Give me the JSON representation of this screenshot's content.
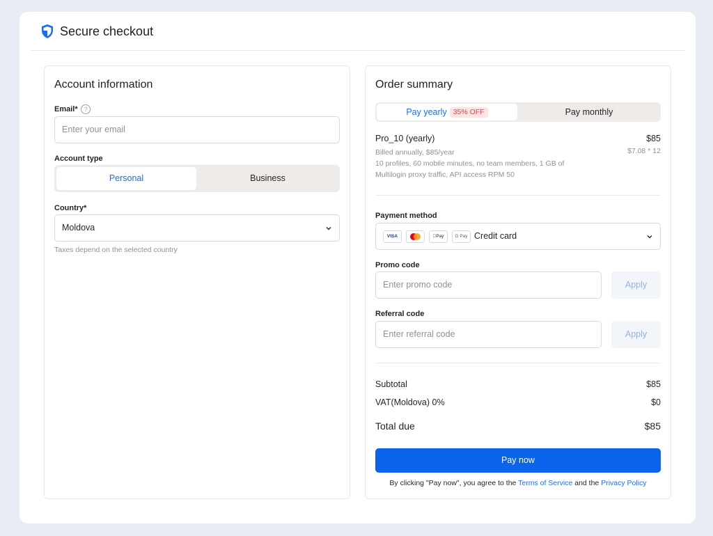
{
  "header": {
    "title": "Secure checkout",
    "icon": "shield-icon"
  },
  "account": {
    "title": "Account information",
    "email_label": "Email*",
    "email_placeholder": "Enter your email",
    "account_type_label": "Account type",
    "account_types": [
      "Personal",
      "Business"
    ],
    "account_type_selected": "Personal",
    "country_label": "Country*",
    "country_value": "Moldova",
    "country_hint": "Taxes depend on the selected country"
  },
  "order": {
    "title": "Order summary",
    "billing": {
      "yearly_label": "Pay yearly",
      "yearly_badge": "35% OFF",
      "monthly_label": "Pay monthly",
      "selected": "yearly"
    },
    "plan": {
      "name": "Pro_10 (yearly)",
      "price": "$85",
      "sub_price": "$7.08 * 12",
      "billed": "Billed annually, $85/year",
      "features": "10 profiles, 60 mobile minutes, no team members, 1 GB of Multilogin proxy traffic, API access RPM 50"
    },
    "payment_method_label": "Payment method",
    "payment_cards": [
      "VISA",
      "Mastercard",
      "Apple Pay",
      "G Pay"
    ],
    "payment_method_value": "Credit card",
    "promo_label": "Promo code",
    "promo_placeholder": "Enter promo code",
    "referral_label": "Referral code",
    "referral_placeholder": "Enter referral code",
    "apply_label": "Apply",
    "subtotal_label": "Subtotal",
    "subtotal_value": "$85",
    "vat_label": "VAT(Moldova) 0%",
    "vat_value": "$0",
    "total_label": "Total due",
    "total_value": "$85",
    "pay_button": "Pay now",
    "terms_prefix": "By clicking \"Pay now\", you agree to the",
    "terms_link": "Terms of Service",
    "terms_and": "and the",
    "privacy_link": "Privacy Policy"
  },
  "colors": {
    "accent": "#0b63ec",
    "badge_bg": "#fde3e3",
    "badge_text": "#e0474c"
  }
}
